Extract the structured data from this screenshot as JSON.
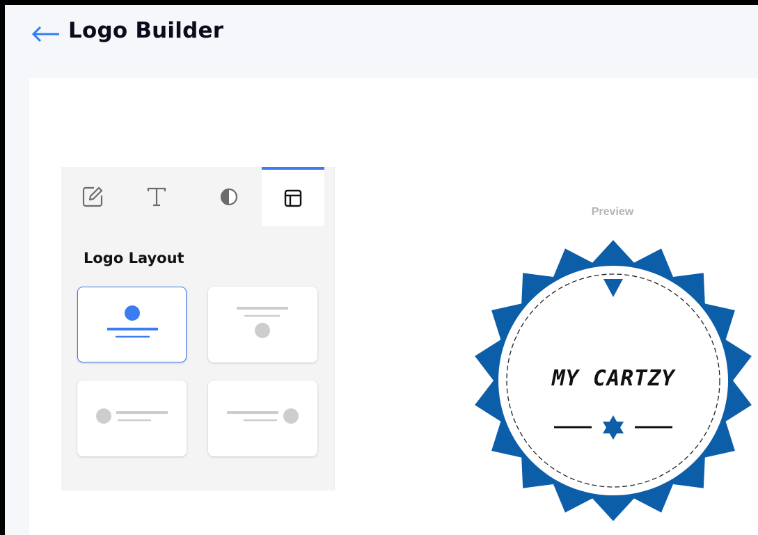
{
  "header": {
    "title": "Logo Builder",
    "back_icon": "arrow-left-icon"
  },
  "colors": {
    "accent": "#3b7df0",
    "badge": "#0d5ea8",
    "placeholder": "#cdcdcd"
  },
  "panel": {
    "tabs": [
      {
        "icon": "edit-icon",
        "active": false
      },
      {
        "icon": "text-icon",
        "active": false
      },
      {
        "icon": "contrast-icon",
        "active": false
      },
      {
        "icon": "layout-icon",
        "active": true
      }
    ],
    "heading": "Logo Layout",
    "layouts": [
      {
        "name": "icon-top",
        "selected": true
      },
      {
        "name": "icon-bottom",
        "selected": false
      },
      {
        "name": "icon-left",
        "selected": false
      },
      {
        "name": "icon-right",
        "selected": false
      }
    ]
  },
  "preview": {
    "label": "Preview",
    "logo_text": "MY CARTZY"
  }
}
